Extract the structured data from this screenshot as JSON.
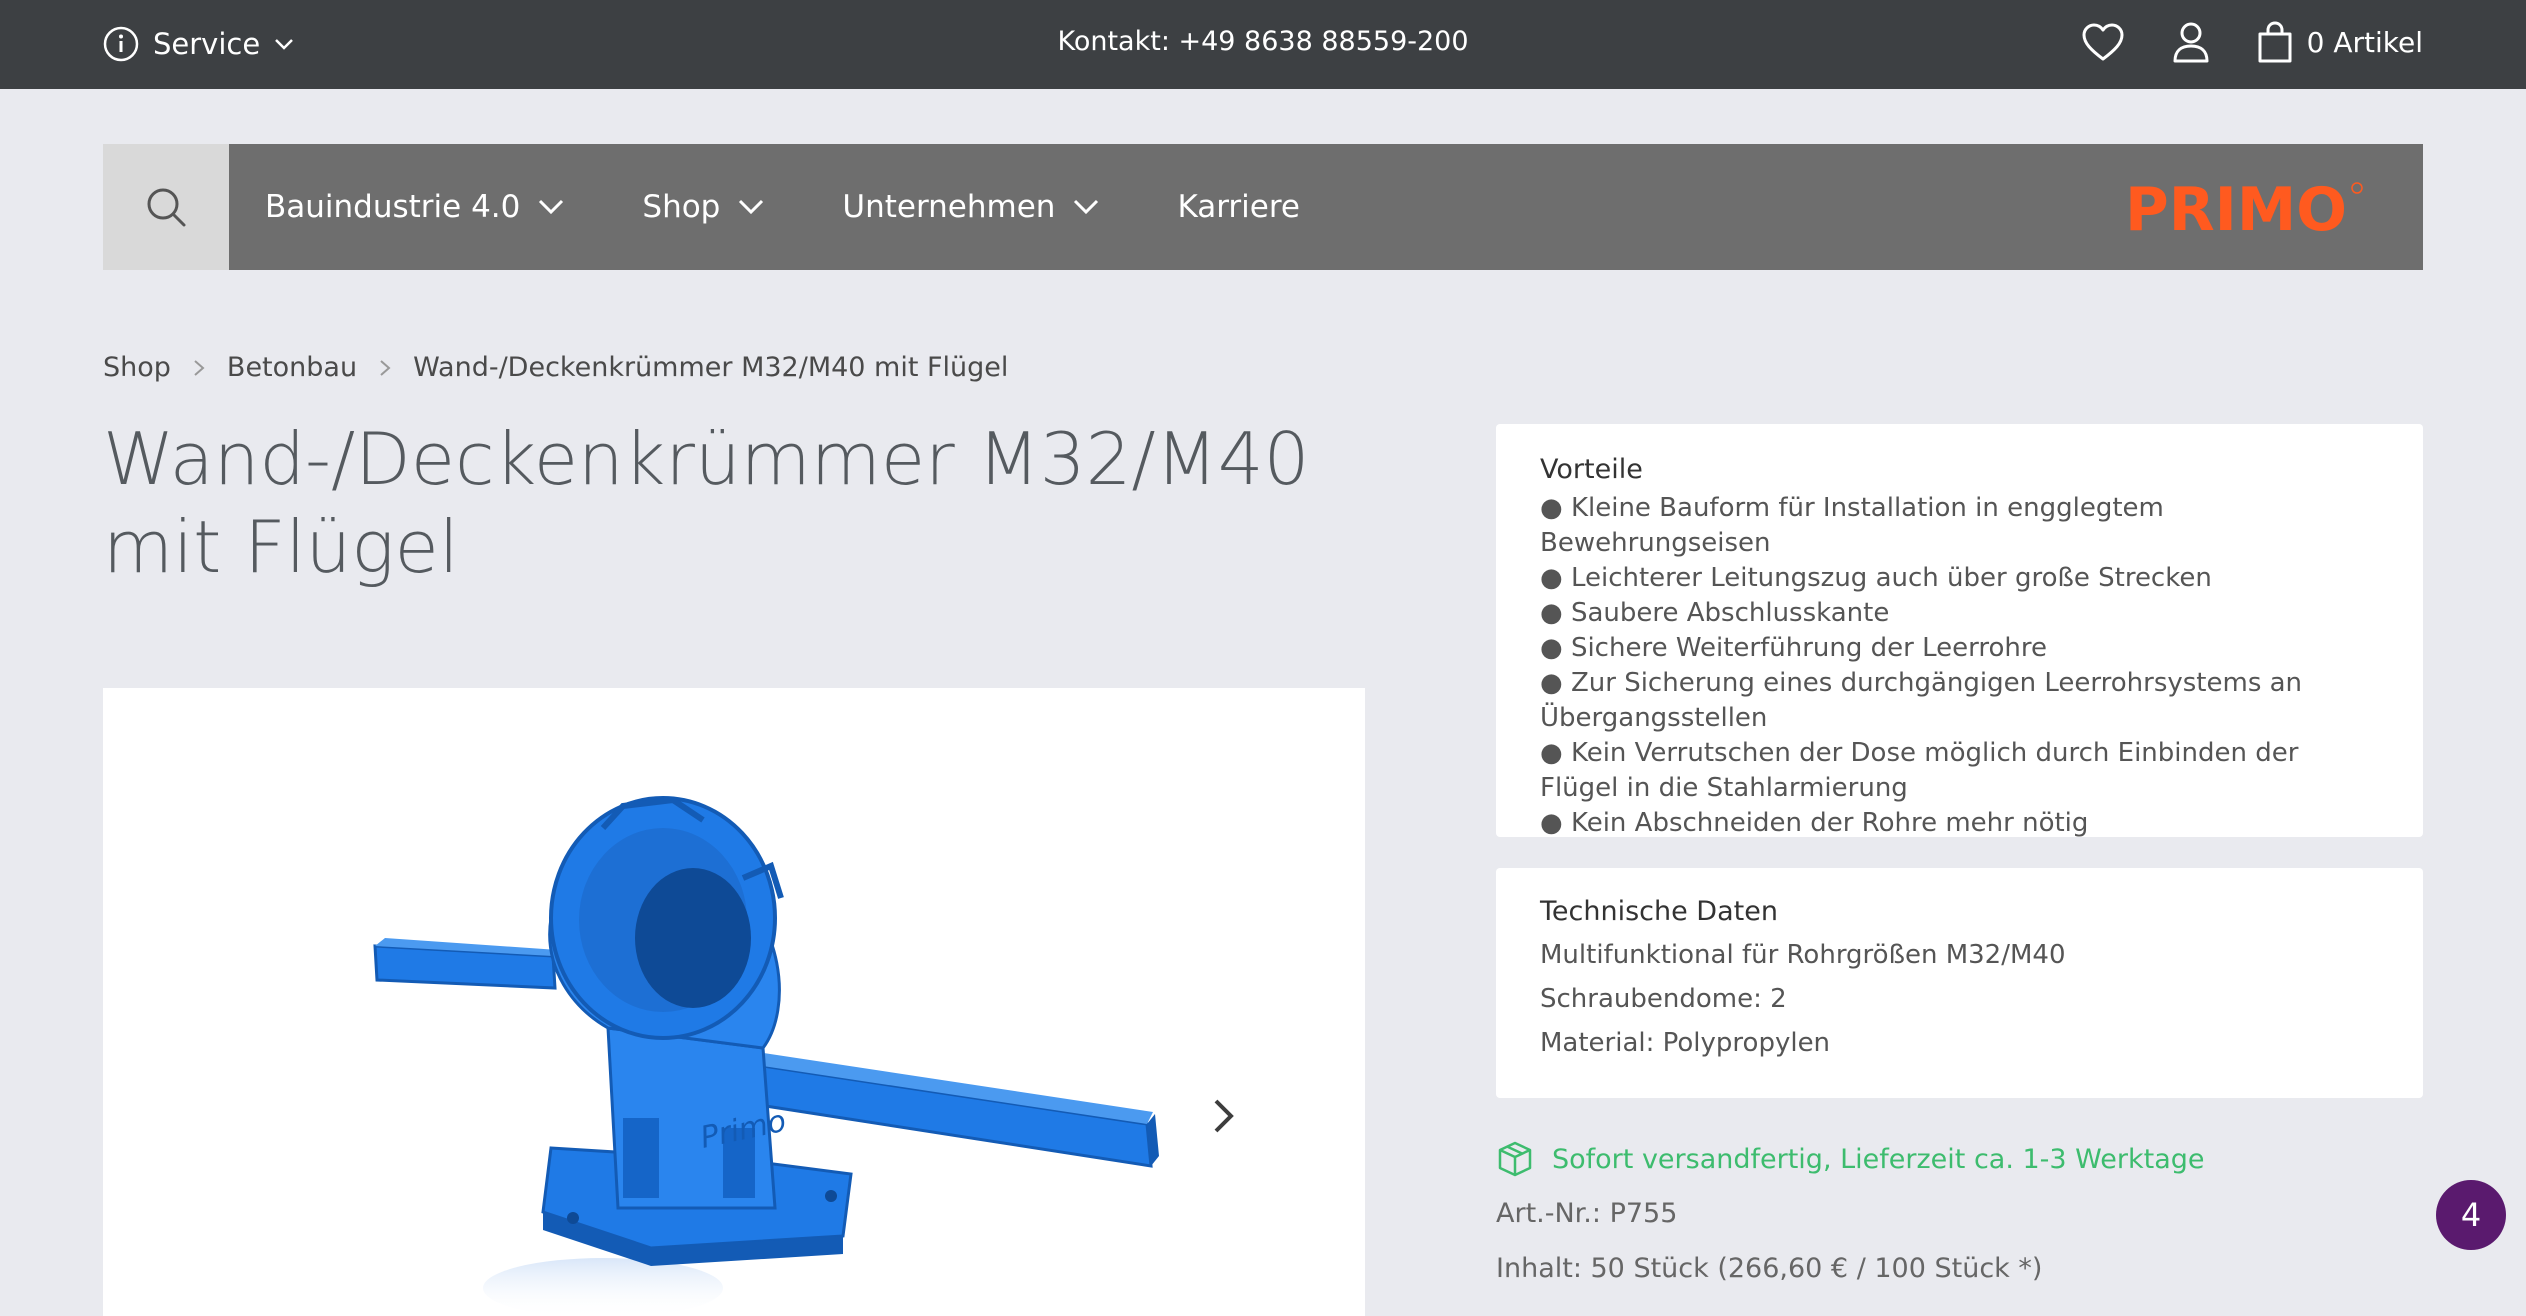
{
  "topbar": {
    "service_label": "Service",
    "contact": "Kontakt: +49 8638 88559-200",
    "cart_label": "0 Artikel"
  },
  "nav": {
    "items": [
      {
        "label": "Bauindustrie 4.0",
        "dropdown": true
      },
      {
        "label": "Shop",
        "dropdown": true
      },
      {
        "label": "Unternehmen",
        "dropdown": true
      },
      {
        "label": "Karriere",
        "dropdown": false
      }
    ],
    "logo_text": "PRIMO"
  },
  "breadcrumb": [
    "Shop",
    "Betonbau",
    "Wand-/Deckenkrümmer M32/M40 mit Flügel"
  ],
  "product": {
    "title": "Wand-/Deckenkrümmer M32/M40 mit Flügel",
    "vorteile_title": "Vorteile",
    "vorteile": [
      "● Kleine Bauform für Installation in engglegtem Bewehrungseisen",
      "● Leichterer Leitungszug auch über große Strecken",
      "● Saubere Abschlusskante",
      "● Sichere Weiterführung der Leerrohre",
      "● Zur Sicherung eines durchgängigen Leerrohrsystems an Übergangsstellen",
      "● Kein Verrutschen der Dose möglich durch Einbinden der Flügel in die Stahlarmierung",
      "● Kein Abschneiden der Rohre mehr nötig"
    ],
    "tech_title": "Technische Daten",
    "tech": [
      "Multifunktional für Rohrgrößen M32/M40",
      "Schraubendome: 2",
      "Material: Polypropylen"
    ],
    "delivery": "Sofort versandfertig, Lieferzeit ca. 1-3 Werktage",
    "art_nr": "Art.-Nr.: P755",
    "inhalt": "Inhalt: 50 Stück (266,60 € / 100 Stück *)"
  },
  "badge_count": "4",
  "colors": {
    "topbar": "#3d4043",
    "navbar": "#6e6e6e",
    "logo": "#ff5a1f",
    "product_blue": "#1f7ae6",
    "delivery_green": "#3dbc6e",
    "badge": "#5a1a6e"
  }
}
